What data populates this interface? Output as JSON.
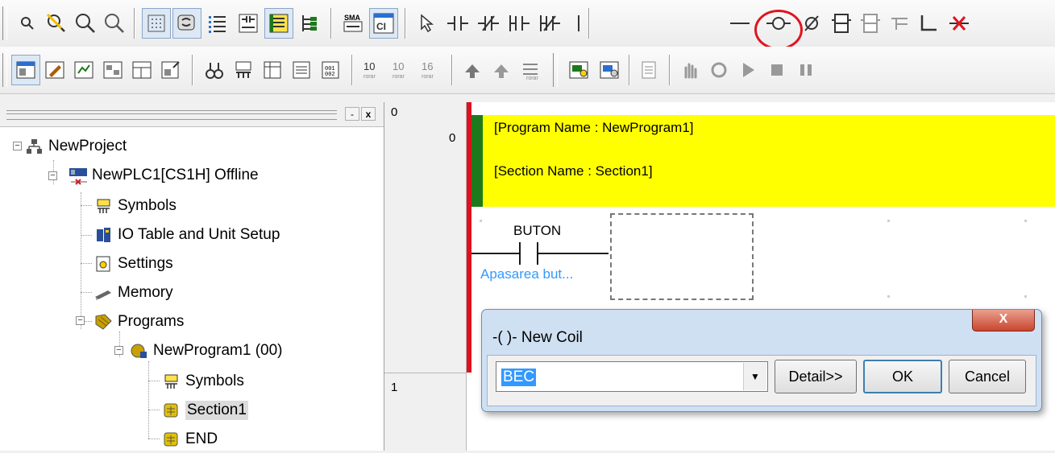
{
  "tree": {
    "header": {
      "minimize": "-",
      "close": "x"
    },
    "nodes": [
      {
        "label": "NewProject",
        "icon": "project-network-icon"
      },
      {
        "label": "NewPLC1[CS1H] Offline",
        "icon": "plc-offline-icon"
      },
      {
        "label": "Symbols",
        "icon": "symbols-icon"
      },
      {
        "label": "IO Table and Unit Setup",
        "icon": "io-table-icon"
      },
      {
        "label": "Settings",
        "icon": "settings-icon"
      },
      {
        "label": "Memory",
        "icon": "memory-icon"
      },
      {
        "label": "Programs",
        "icon": "programs-icon"
      },
      {
        "label": "NewProgram1 (00)",
        "icon": "program-icon"
      },
      {
        "label": "Symbols",
        "icon": "symbols-icon"
      },
      {
        "label": "Section1",
        "icon": "section-icon"
      },
      {
        "label": "END",
        "icon": "section-icon"
      }
    ]
  },
  "ladder": {
    "rung0_left": "0",
    "rung0_step": "0",
    "rung1": "1",
    "program_name": "[Program Name : NewProgram1]",
    "section_name": "[Section Name : Section1]",
    "contact_label": "BUTON",
    "contact_comment": "Apasarea but..."
  },
  "dialog": {
    "title": "-( )- New Coil",
    "close": "X",
    "input_value": "BEC",
    "detail_button": "Detail>>",
    "ok_button": "OK",
    "cancel_button": "Cancel"
  },
  "colors": {
    "comment_band": "#ffff00",
    "power_rail": "#e0101e",
    "highlight_circle": "#e0141e",
    "comment_text": "#3399ff"
  }
}
